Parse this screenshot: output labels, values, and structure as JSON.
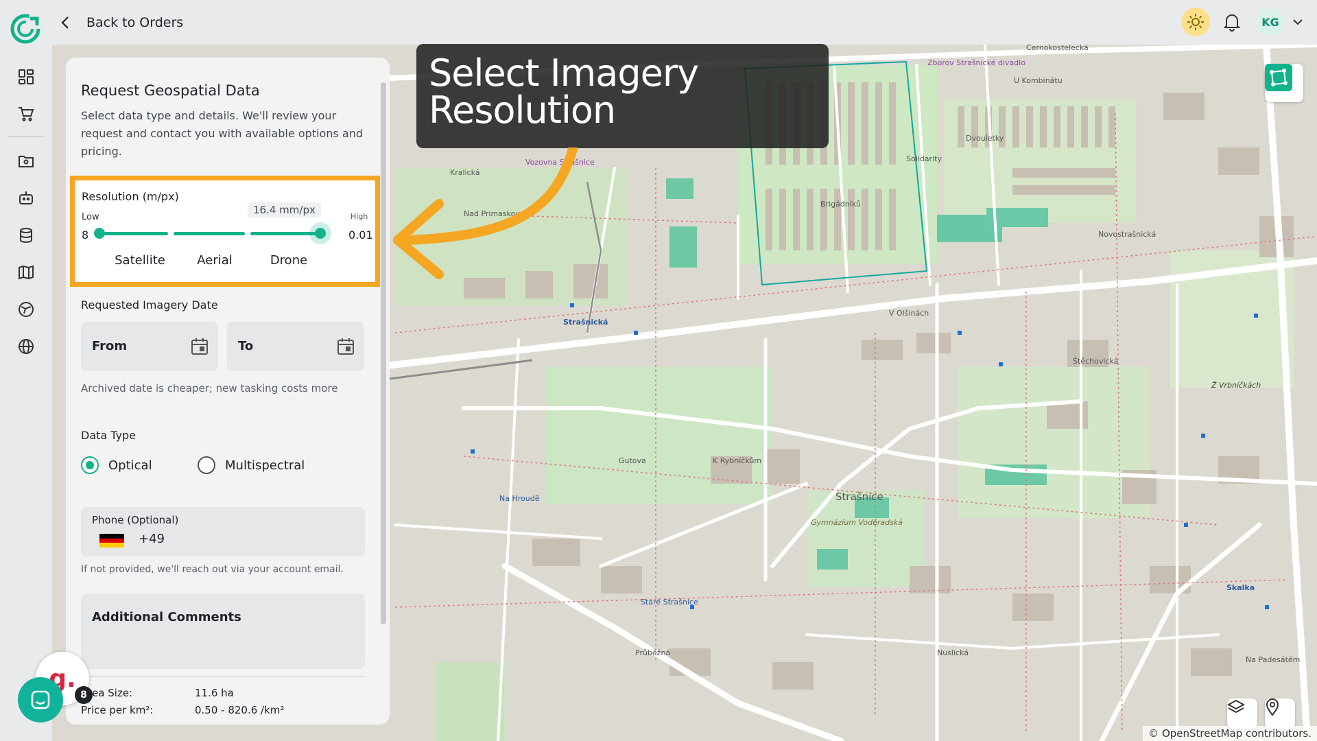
{
  "header": {
    "back_label": "Back to Orders",
    "user_initials": "KG",
    "icons": [
      "logo-icon",
      "chevron-left-icon",
      "sun-icon",
      "bell-icon",
      "chevron-down-icon"
    ]
  },
  "sidebar": {
    "items": [
      {
        "name": "dashboard",
        "icon": "grid-icon"
      },
      {
        "name": "cart",
        "icon": "cart-icon"
      },
      {
        "name": "folder",
        "icon": "folder-icon"
      },
      {
        "name": "robot",
        "icon": "robot-icon"
      },
      {
        "name": "database",
        "icon": "database-icon"
      },
      {
        "name": "map",
        "icon": "map-icon"
      },
      {
        "name": "globe-network",
        "icon": "globe-network-icon"
      },
      {
        "name": "globe",
        "icon": "globe-icon"
      }
    ]
  },
  "tooltip": {
    "line1": "Select Imagery",
    "line2": "Resolution"
  },
  "panel": {
    "title": "Request Geospatial Data",
    "description": "Select data type and details. We'll review your request and contact you with available options and pricing.",
    "resolution": {
      "label": "Resolution (m/px)",
      "low_label": "Low",
      "high_label": "High",
      "min": "8",
      "max": "0.01",
      "current": "16.4 mm/px",
      "categories": [
        "Satellite",
        "Aerial",
        "Drone"
      ]
    },
    "date": {
      "label": "Requested Imagery Date",
      "from": "From",
      "to": "To",
      "hint": "Archived date is cheaper; new tasking costs more"
    },
    "data_type": {
      "label": "Data Type",
      "options": [
        "Optical",
        "Multispectral"
      ],
      "selected": "Optical"
    },
    "phone": {
      "label": "Phone (Optional)",
      "code": "+49",
      "hint": "If not provided, we'll reach out via your account email."
    },
    "comments": {
      "label": "Additional Comments"
    },
    "area": {
      "label": "Area Size:",
      "value": "11.6 ha"
    },
    "price": {
      "label": "Price per km²:",
      "value": "0.50 - 820.6 /km²"
    }
  },
  "map": {
    "attribution": "© OpenStreetMap contributors.",
    "labels": [
      "Černokostelecká",
      "V Olšinách",
      "Strašnická",
      "Strašnice",
      "Průběžná",
      "Na Hroudě",
      "Nad Primaskou",
      "Kralická",
      "Gutova",
      "K Rybníčkům",
      "Štěchovická",
      "Vozovna Strašnice",
      "Zborov Strašnické divadlo",
      "U Kombinátu",
      "Dvouletky",
      "Brigádníků",
      "Solidarity",
      "Gymnázium Voděradská",
      "Staré Strašnice",
      "Skalka",
      "Ž Vrbníčkách",
      "Na Padesátém",
      "Novostrašnická",
      "Nuslická"
    ]
  },
  "chat": {
    "g_label": "g.",
    "badge": "8"
  },
  "colors": {
    "accent": "#12b28c",
    "highlight": "#f5a623",
    "tooltip_bg": "#202020"
  }
}
